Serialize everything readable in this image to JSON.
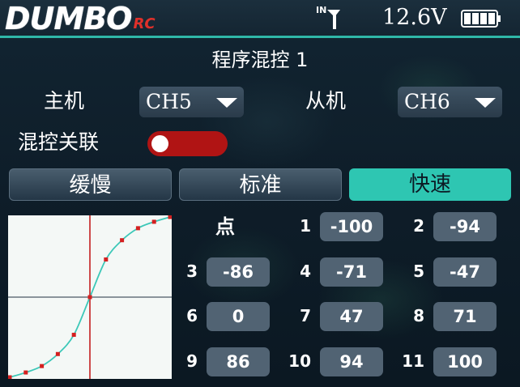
{
  "header": {
    "logo_main": "DUMBO",
    "logo_sub": "RC",
    "signal_label": "IN",
    "voltage": "12.6V",
    "battery_level": 1.0
  },
  "title": "程序混控 1",
  "master": {
    "label": "主机",
    "value": "CH5",
    "icon": "chevron-down-icon"
  },
  "slave": {
    "label": "从机",
    "value": "CH6",
    "icon": "chevron-down-icon"
  },
  "mix_link": {
    "label": "混控关联",
    "state": "on"
  },
  "tabs": [
    {
      "label": "缓慢",
      "active": false
    },
    {
      "label": "标准",
      "active": false
    },
    {
      "label": "快速",
      "active": true
    }
  ],
  "points_header": "点",
  "points": [
    {
      "n": "1",
      "value": "-100"
    },
    {
      "n": "2",
      "value": "-94"
    },
    {
      "n": "3",
      "value": "-86"
    },
    {
      "n": "4",
      "value": "-71"
    },
    {
      "n": "5",
      "value": "-47"
    },
    {
      "n": "6",
      "value": "0"
    },
    {
      "n": "7",
      "value": "47"
    },
    {
      "n": "8",
      "value": "71"
    },
    {
      "n": "9",
      "value": "86"
    },
    {
      "n": "10",
      "value": "94"
    },
    {
      "n": "11",
      "value": "100"
    }
  ],
  "colors": {
    "accent": "#2ec6b2",
    "toggle_on": "#b01414",
    "curve": "#3cc8b8",
    "points": "#d42020",
    "axis": "#c01010"
  }
}
